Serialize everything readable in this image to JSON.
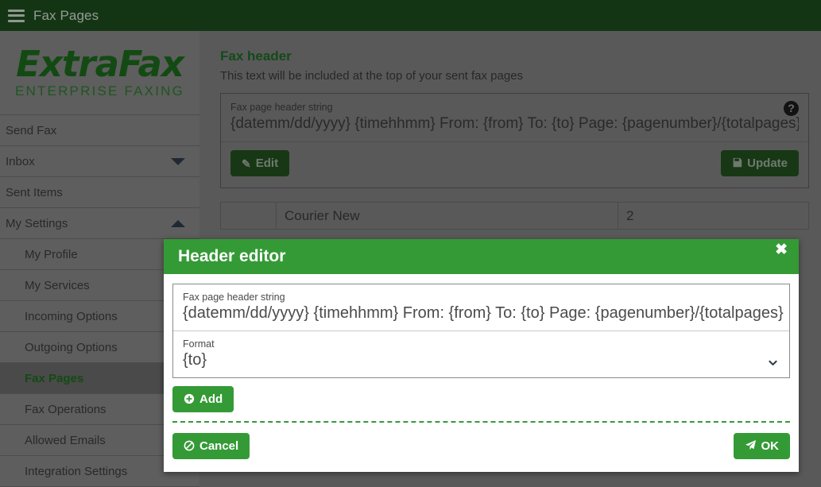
{
  "topbar": {
    "menu_icon": "hamburger-icon",
    "title": "Fax Pages"
  },
  "sidebar": {
    "brand": {
      "name": "ExtraFax",
      "tagline": "ENTERPRISE FAXING"
    },
    "items": [
      {
        "label": "Send Fax",
        "level": 0,
        "caret": "",
        "active": false
      },
      {
        "label": "Inbox",
        "level": 0,
        "caret": "down",
        "active": false
      },
      {
        "label": "Sent Items",
        "level": 0,
        "caret": "",
        "active": false
      },
      {
        "label": "My Settings",
        "level": 0,
        "caret": "up",
        "active": false
      },
      {
        "label": "My Profile",
        "level": 1,
        "caret": "",
        "active": false
      },
      {
        "label": "My Services",
        "level": 1,
        "caret": "",
        "active": false
      },
      {
        "label": "Incoming Options",
        "level": 1,
        "caret": "",
        "active": false
      },
      {
        "label": "Outgoing Options",
        "level": 1,
        "caret": "",
        "active": false
      },
      {
        "label": "Fax Pages",
        "level": 1,
        "caret": "",
        "active": true
      },
      {
        "label": "Fax Operations",
        "level": 1,
        "caret": "",
        "active": false
      },
      {
        "label": "Allowed Emails",
        "level": 1,
        "caret": "",
        "active": false
      },
      {
        "label": "Integration Settings",
        "level": 1,
        "caret": "",
        "active": false
      }
    ]
  },
  "main": {
    "section_title": "Fax header",
    "section_subtitle": "This text will be included at the top of your sent fax pages",
    "header_field": {
      "label": "Fax page header string",
      "value": "{datemm/dd/yyyy} {timehhmm}   From: {from}   To: {to}   Page: {pagenumber}/{totalpages}",
      "help_icon": "question-mark-icon",
      "help_glyph": "?"
    },
    "edit_button": {
      "label": "Edit",
      "icon": "pencil-icon",
      "glyph": "✎"
    },
    "update_button": {
      "label": "Update",
      "icon": "save-disk-icon",
      "glyph": "💾"
    },
    "background_rows": [
      {
        "col_a": "",
        "col_b": "Courier New",
        "col_c": "2"
      }
    ]
  },
  "modal": {
    "title": "Header editor",
    "close_icon": "close-x-icon",
    "close_glyph": "✖",
    "header_string": {
      "label": "Fax page header string",
      "value": "{datemm/dd/yyyy} {timehhmm}   From: {from}   To: {to}   Page: {pagenumber}/{totalpages}"
    },
    "format": {
      "label": "Format",
      "value": "{to}",
      "chevron_icon": "chevron-down-icon"
    },
    "add_button": {
      "label": "Add",
      "icon": "plus-circle-icon",
      "glyph": "⊕"
    },
    "cancel_button": {
      "label": "Cancel",
      "icon": "ban-icon",
      "glyph": "⊘"
    },
    "ok_button": {
      "label": "OK",
      "icon": "paper-plane-icon",
      "glyph": "➤"
    }
  },
  "colors": {
    "topbar_green": "#1d4d1d",
    "modal_green": "#349a36",
    "accent_green": "#1e6a24",
    "page_gray": "#808080",
    "sidebar_gray": "#878787"
  }
}
